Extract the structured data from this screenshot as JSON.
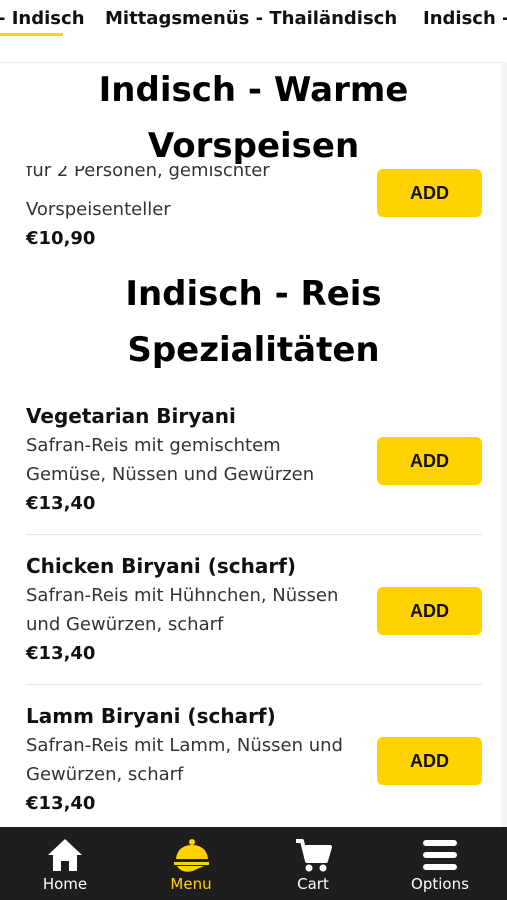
{
  "tabs": [
    {
      "label": "- Indisch",
      "active": true
    },
    {
      "label": "Mittagsmenüs - Thailändisch",
      "active": false
    },
    {
      "label": "Indisch -",
      "active": false
    }
  ],
  "sections": [
    {
      "title_line1": "Indisch - Warme",
      "title_line2": "Vorspeisen"
    },
    {
      "title_line1": "Indisch - Reis",
      "title_line2": "Spezialitäten"
    }
  ],
  "partial_item": {
    "desc_hidden_line": "für 2 Personen, gemischter",
    "desc_line": "Vorspeisenteller",
    "price": "€10,90",
    "button": "ADD"
  },
  "items": [
    {
      "name": "Vegetarian Biryani",
      "desc_line1": "Safran-Reis mit gemischtem",
      "desc_line2": "Gemüse, Nüssen und Gewürzen",
      "price": "€13,40",
      "button": "ADD"
    },
    {
      "name": "Chicken Biryani (scharf)",
      "desc_line1": "Safran-Reis mit Hühnchen, Nüssen",
      "desc_line2": "und Gewürzen, scharf",
      "price": "€13,40",
      "button": "ADD"
    },
    {
      "name": "Lamm Biryani (scharf)",
      "desc_line1": "Safran-Reis mit Lamm, Nüssen und",
      "desc_line2": "Gewürzen, scharf",
      "price": "€13,40",
      "button": "ADD"
    }
  ],
  "nav": [
    {
      "label": "Home",
      "icon": "home-icon",
      "active": false
    },
    {
      "label": "Menu",
      "icon": "menu-cloche-icon",
      "active": true
    },
    {
      "label": "Cart",
      "icon": "cart-icon",
      "active": false
    },
    {
      "label": "Options",
      "icon": "hamburger-icon",
      "active": false
    }
  ],
  "colors": {
    "accent": "#ffd200",
    "nav_bg": "#1e1e1e"
  }
}
